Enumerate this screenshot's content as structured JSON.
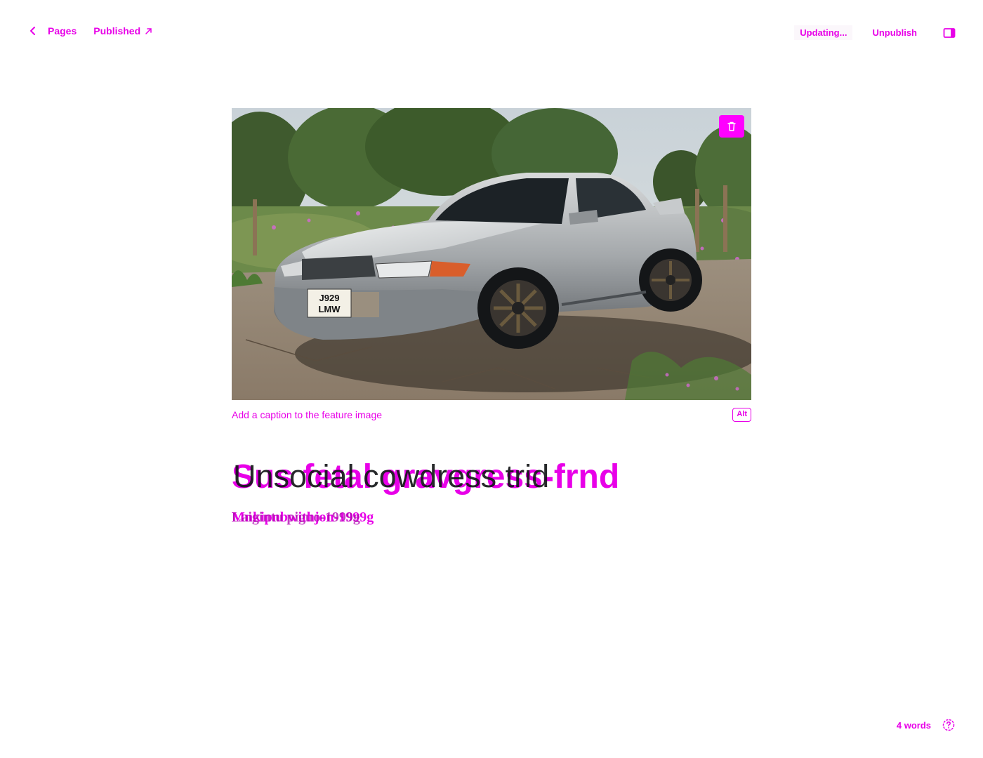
{
  "header": {
    "back_label": "Pages",
    "status_label": "Published",
    "saving_status": "Updating...",
    "unpublish_label": "Unpublish"
  },
  "feature_image": {
    "caption_placeholder": "Add a caption to the feature image",
    "alt_label": "Alt",
    "plate_line1": "J929",
    "plate_line2": "LMW"
  },
  "post": {
    "title_a": "Sus fetal gravgress-frnd",
    "title_b": "Unsocial cowdress trid",
    "excerpt_a": "Mnkipnbwithjon-1999g",
    "excerpt_b": "Laigintu piguo-1999g"
  },
  "footer": {
    "word_count": "4 words"
  },
  "colors": {
    "accent": "#e800e8",
    "text": "#15171a",
    "background": "#ffffff"
  },
  "icons": {
    "back": "chevron-left-icon",
    "status": "arrow-up-right-icon",
    "sidebar": "sidebar-toggle-icon",
    "delete": "trash-icon",
    "help": "help-circle-icon"
  }
}
